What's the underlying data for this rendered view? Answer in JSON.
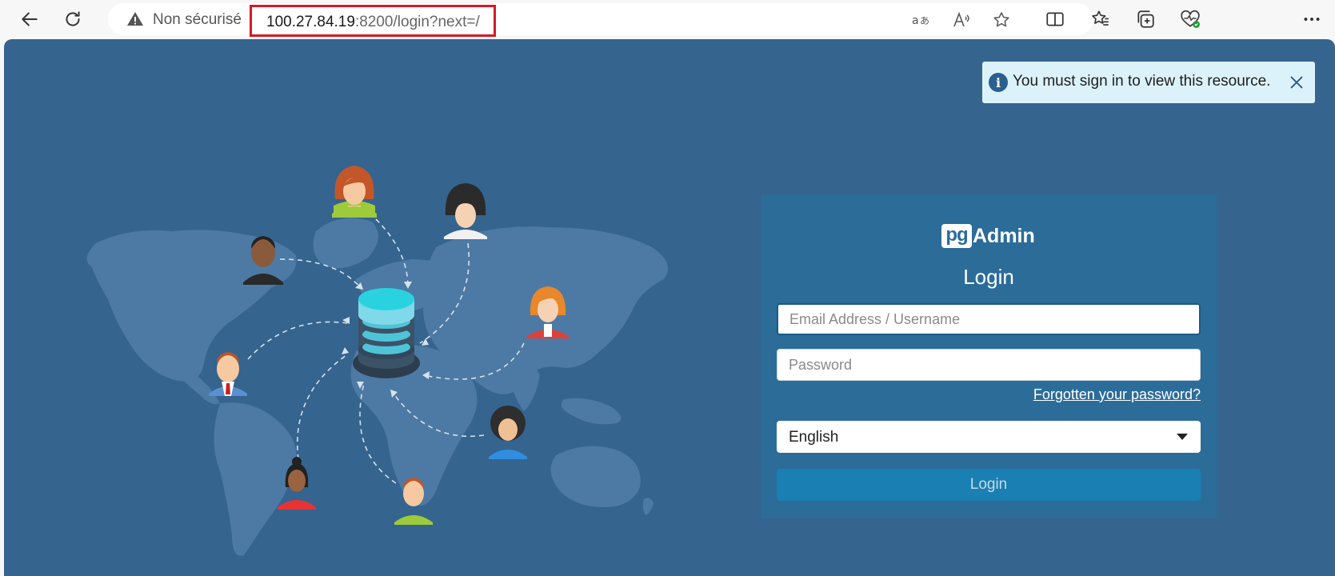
{
  "browser": {
    "security_label": "Non sécurisé",
    "url_host": "100.27.84.19",
    "url_rest": ":8200/login?next=/"
  },
  "alert": {
    "message": "You must sign in to view this resource."
  },
  "login": {
    "logo_badge": "pg",
    "logo_word": "Admin",
    "title": "Login",
    "email_placeholder": "Email Address / Username",
    "password_placeholder": "Password",
    "forgot_link": "Forgotten your password?",
    "language_selected": "English",
    "button_label": "Login"
  },
  "colors": {
    "page_bg": "#35648f",
    "panel_bg": "#2c6c99",
    "button_bg": "#1a7fb3",
    "alert_bg": "#dcf2fb",
    "url_highlight": "#d61a26"
  }
}
